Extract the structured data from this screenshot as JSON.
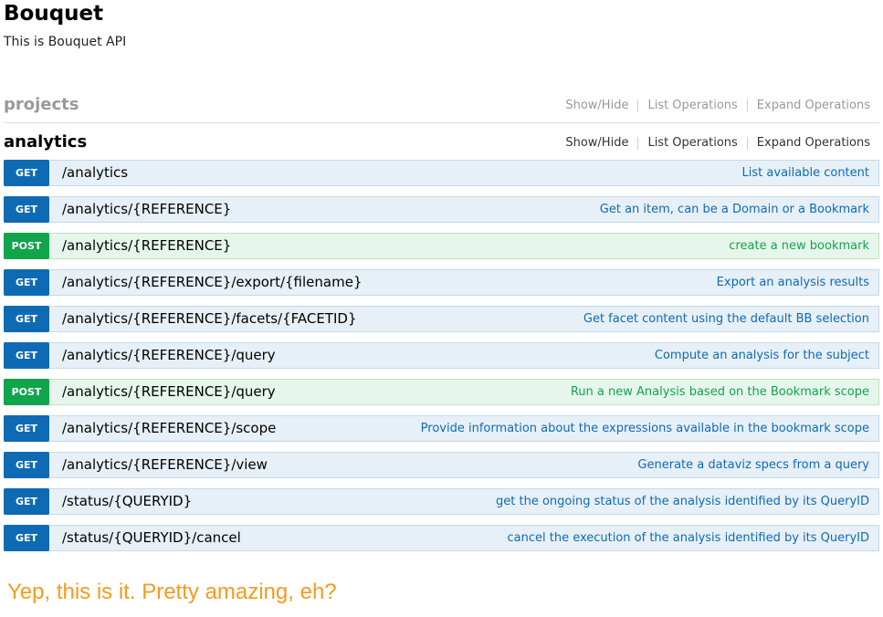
{
  "header": {
    "title": "Bouquet",
    "subtitle": "This is Bouquet API"
  },
  "resources": [
    {
      "name": "projects",
      "state": "collapsed",
      "show_hide": "Show/Hide",
      "list_operations": "List Operations",
      "expand_operations": "Expand Operations"
    },
    {
      "name": "analytics",
      "state": "expanded",
      "show_hide": "Show/Hide",
      "list_operations": "List Operations",
      "expand_operations": "Expand Operations"
    }
  ],
  "operations": [
    {
      "method": "GET",
      "path": "/analytics",
      "summary": "List available content"
    },
    {
      "method": "GET",
      "path": "/analytics/{REFERENCE}",
      "summary": "Get an item, can be a Domain or a Bookmark"
    },
    {
      "method": "POST",
      "path": "/analytics/{REFERENCE}",
      "summary": "create a new bookmark"
    },
    {
      "method": "GET",
      "path": "/analytics/{REFERENCE}/export/{filename}",
      "summary": "Export an analysis results"
    },
    {
      "method": "GET",
      "path": "/analytics/{REFERENCE}/facets/{FACETID}",
      "summary": "Get facet content using the default BB selection"
    },
    {
      "method": "GET",
      "path": "/analytics/{REFERENCE}/query",
      "summary": "Compute an analysis for the subject"
    },
    {
      "method": "POST",
      "path": "/analytics/{REFERENCE}/query",
      "summary": "Run a new Analysis based on the Bookmark scope"
    },
    {
      "method": "GET",
      "path": "/analytics/{REFERENCE}/scope",
      "summary": "Provide information about the expressions available in the bookmark scope"
    },
    {
      "method": "GET",
      "path": "/analytics/{REFERENCE}/view",
      "summary": "Generate a dataviz specs from a query"
    },
    {
      "method": "GET",
      "path": "/status/{QUERYID}",
      "summary": "get the ongoing status of the analysis identified by its QueryID"
    },
    {
      "method": "GET",
      "path": "/status/{QUERYID}/cancel",
      "summary": "cancel the execution of the analysis identified by its QueryID"
    }
  ],
  "footer": {
    "note": "Yep, this is it. Pretty amazing, eh?"
  },
  "colors": {
    "get": "#0f6ab4",
    "post": "#10a54a",
    "get_row_bg": "#e7f0f7",
    "post_row_bg": "#e7f6ec",
    "note": "#f79a1e"
  }
}
